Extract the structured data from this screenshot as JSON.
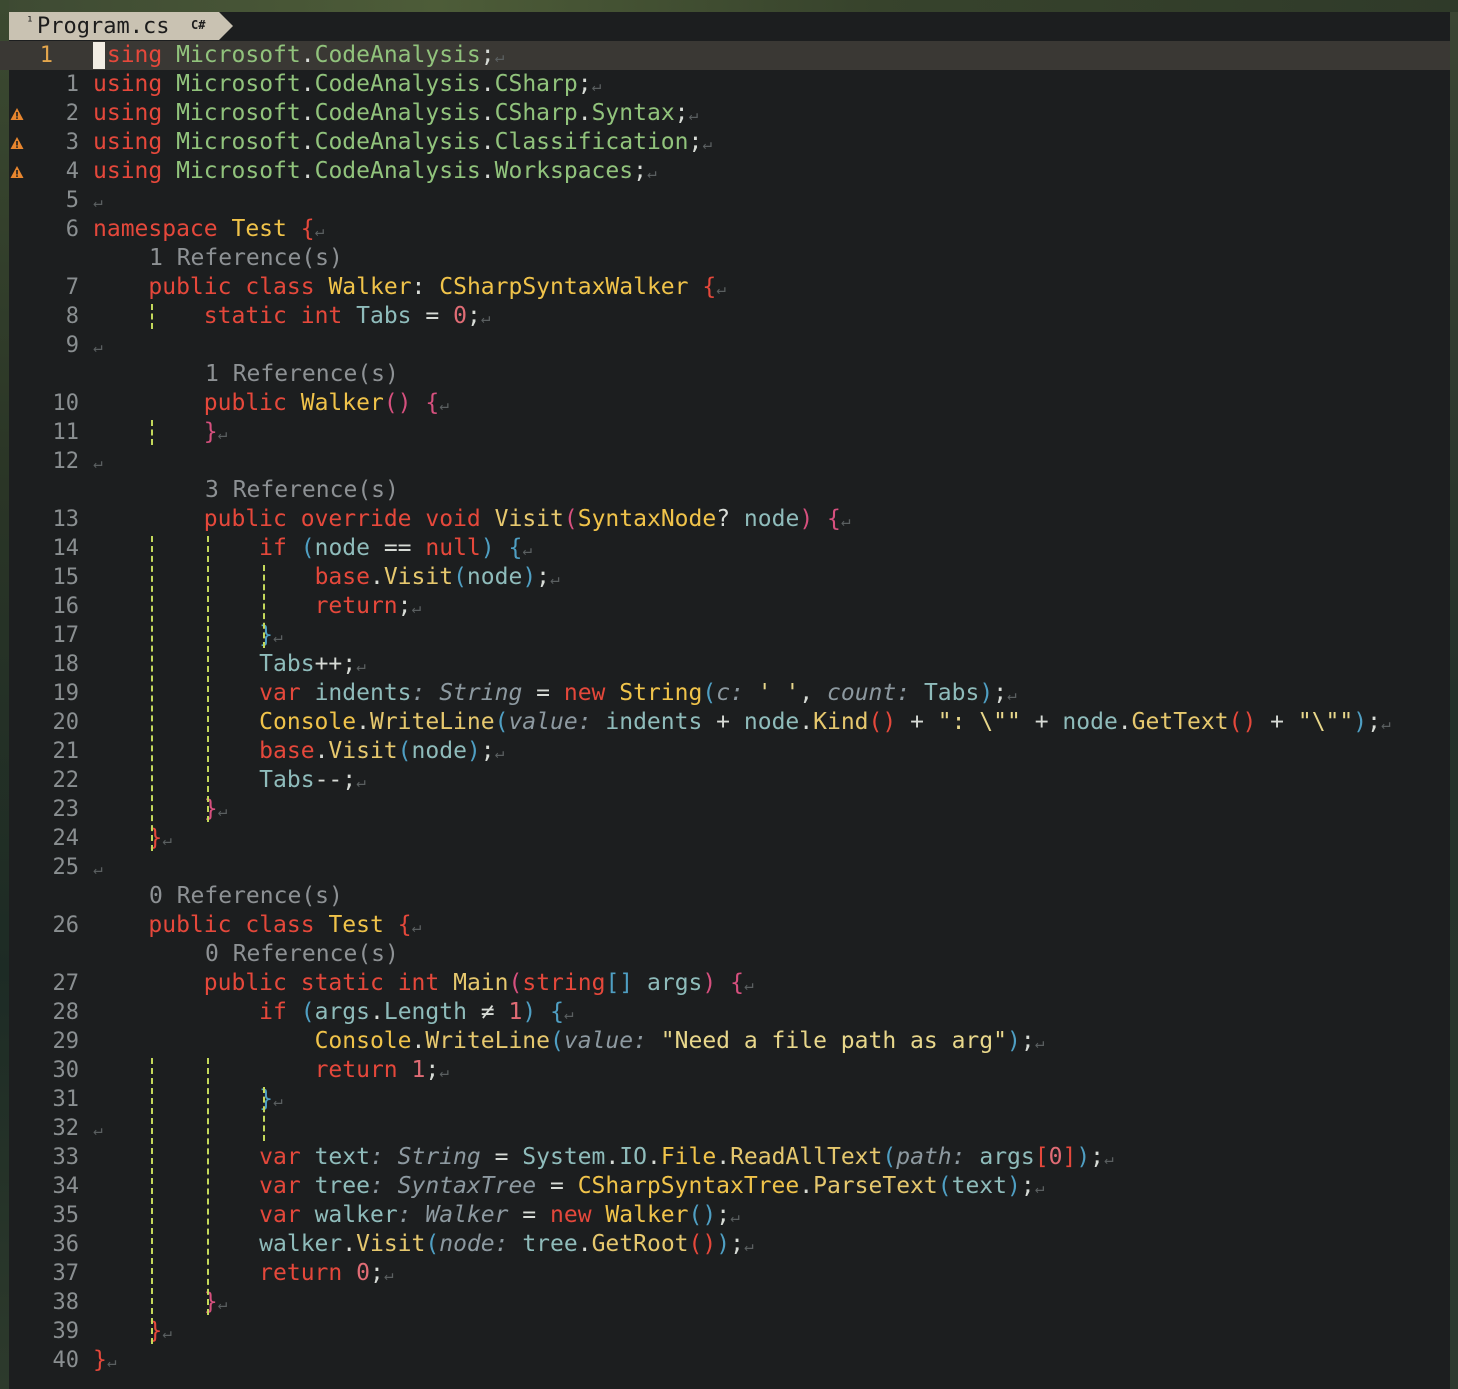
{
  "tab": {
    "modified_marker": "¹",
    "title": "Program.cs",
    "language_badge": "C#"
  },
  "current_line_number": "1",
  "ref_labels": {
    "walker_class": "1 Reference(s)",
    "walker_ctor": "1 Reference(s)",
    "visit": "3 Reference(s)",
    "test_class": "0 Reference(s)",
    "main": "0 Reference(s)"
  },
  "line_numbers": [
    "1",
    "2",
    "3",
    "4",
    "5",
    "6",
    "7",
    "8",
    "9",
    "10",
    "11",
    "12",
    "13",
    "14",
    "15",
    "16",
    "17",
    "18",
    "19",
    "20",
    "21",
    "22",
    "23",
    "24",
    "25",
    "26",
    "27",
    "28",
    "29",
    "30",
    "31",
    "32",
    "33",
    "34",
    "35",
    "36",
    "37",
    "38",
    "39",
    "40"
  ],
  "warnings_on_lines": [
    "2",
    "3",
    "4"
  ],
  "colors": {
    "keyword": "#e5483b",
    "type": "#f0c34a",
    "namespace": "#91c37c",
    "current_line": "#3a3834",
    "indent_guide": "#c3d85b"
  }
}
